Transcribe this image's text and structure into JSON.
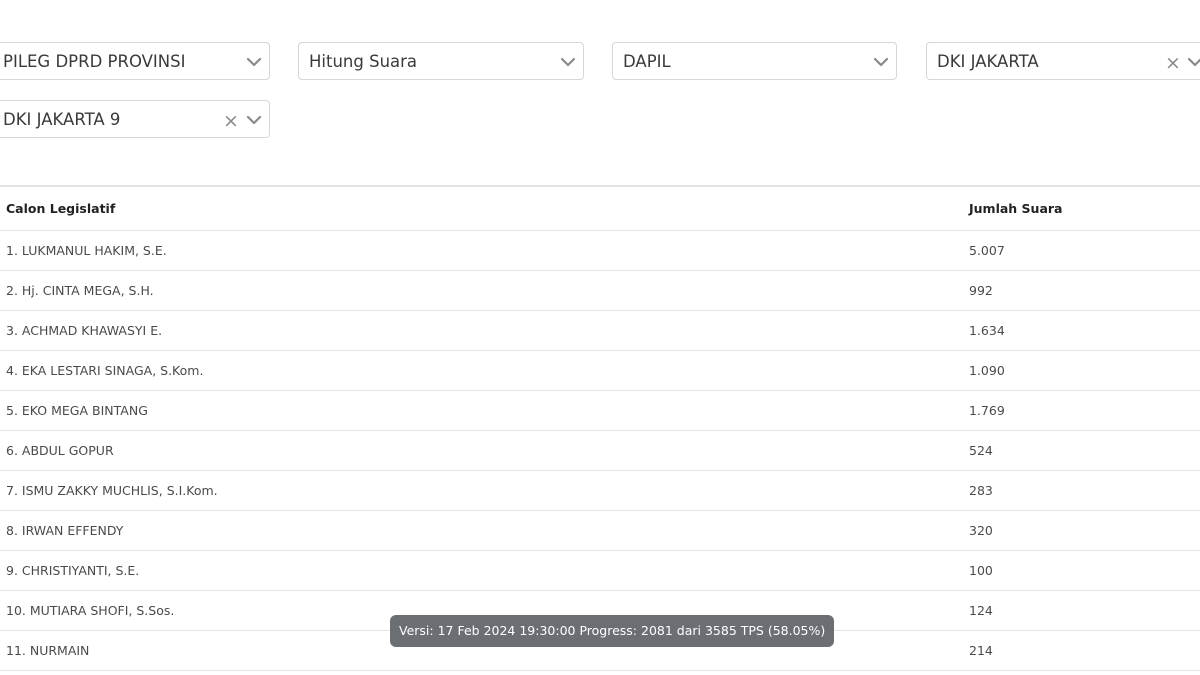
{
  "filters": {
    "election_type": {
      "value": "PILEG DPRD PROVINSI"
    },
    "count_type": {
      "value": "Hitung Suara"
    },
    "region_level": {
      "value": "DAPIL"
    },
    "province": {
      "value": "DKI JAKARTA",
      "clear_symbol": "×"
    },
    "district": {
      "value": "DKI JAKARTA 9",
      "clear_symbol": "×"
    }
  },
  "table": {
    "headers": [
      "Calon Legislatif",
      "Jumlah Suara"
    ],
    "rows": [
      {
        "name": "1. LUKMANUL HAKIM, S.E.",
        "votes": "5.007"
      },
      {
        "name": "2. Hj. CINTA MEGA, S.H.",
        "votes": "992"
      },
      {
        "name": "3. ACHMAD KHAWASYI E.",
        "votes": "1.634"
      },
      {
        "name": "4. EKA LESTARI SINAGA, S.Kom.",
        "votes": "1.090"
      },
      {
        "name": "5. EKO MEGA BINTANG",
        "votes": "1.769"
      },
      {
        "name": "6. ABDUL GOPUR",
        "votes": "524"
      },
      {
        "name": "7. ISMU ZAKKY MUCHLIS, S.I.Kom.",
        "votes": "283"
      },
      {
        "name": "8. IRWAN EFFENDY",
        "votes": "320"
      },
      {
        "name": "9. CHRISTIYANTI, S.E.",
        "votes": "100"
      },
      {
        "name": "10. MUTIARA SHOFI, S.Sos.",
        "votes": "124"
      },
      {
        "name": "11. NURMAIN",
        "votes": "214"
      }
    ]
  },
  "tooltip": {
    "text": "Versi: 17 Feb 2024 19:30:00 Progress: 2081 dari 3585 TPS (58.05%)"
  },
  "icons": {
    "dropdown": "chevron-down-icon",
    "clear": "close-icon"
  },
  "colors": {
    "border": "#d6d6d6",
    "tooltip_bg": "#6b6e73",
    "chevron": "#8a8a8a"
  }
}
